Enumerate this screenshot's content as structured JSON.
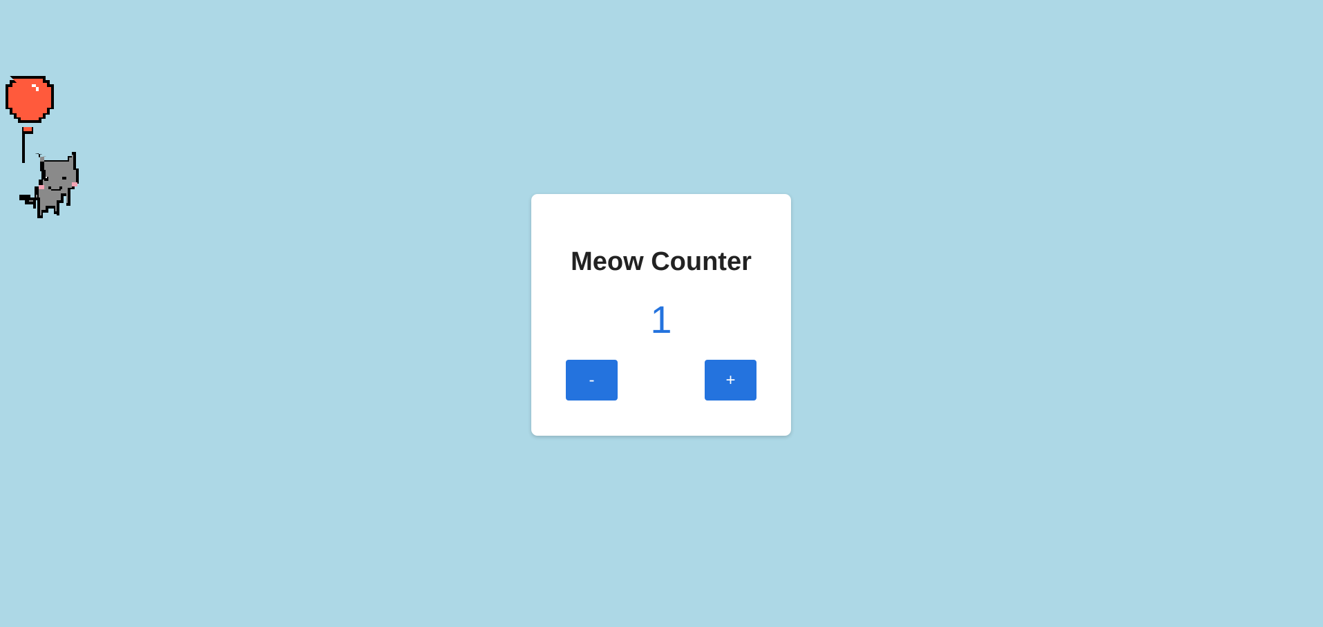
{
  "counter": {
    "title": "Meow Counter",
    "value": "1",
    "decrement_label": "-",
    "increment_label": "+"
  },
  "mascot": {
    "icon": "cat-with-balloon-icon",
    "balloon_color": "#ff5a3c",
    "cat_color": "#8a8a8a"
  },
  "colors": {
    "background": "#add8e6",
    "card": "#ffffff",
    "accent": "#2473de",
    "title_text": "#222222"
  }
}
